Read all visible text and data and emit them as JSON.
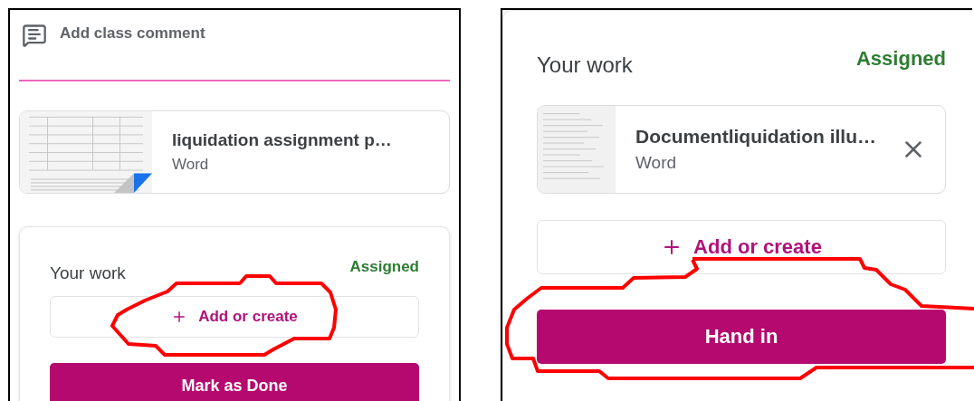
{
  "left_panel": {
    "comment_field": {
      "placeholder": "Add class comment"
    },
    "attachments": [
      {
        "title": "liquidation assignment p…",
        "type": "Word",
        "kind": "table"
      }
    ],
    "your_work": {
      "title": "Your work",
      "status": "Assigned",
      "add_button": "Add or create",
      "action_button": "Mark as Done"
    }
  },
  "right_panel": {
    "your_work": {
      "title": "Your work",
      "status": "Assigned",
      "attachments": [
        {
          "title": "Documentliquidation illu…",
          "type": "Word",
          "kind": "list"
        }
      ],
      "add_button": "Add or create",
      "action_button": "Hand in"
    }
  }
}
